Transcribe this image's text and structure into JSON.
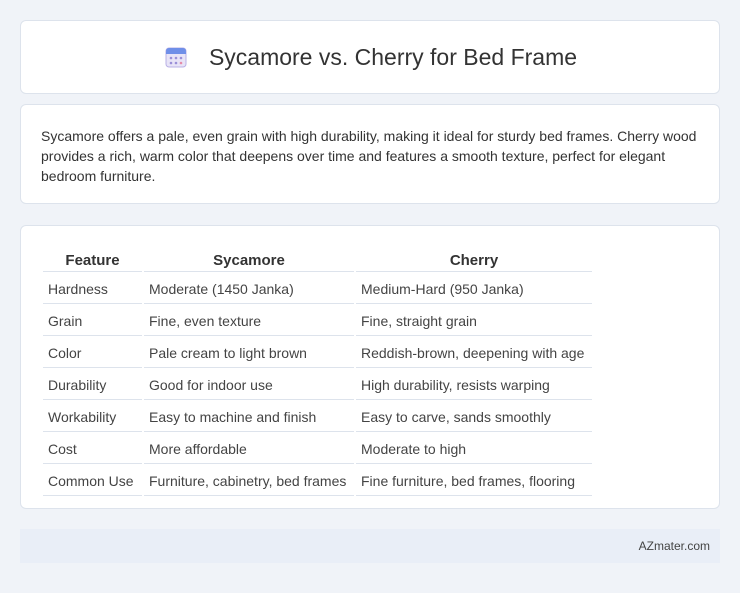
{
  "header": {
    "title": "Sycamore vs. Cherry for Bed Frame",
    "icon": "calendar-icon"
  },
  "summary": {
    "text": "Sycamore offers a pale, even grain with high durability, making it ideal for sturdy bed frames. Cherry wood provides a rich, warm color that deepens over time and features a smooth texture, perfect for elegant bedroom furniture."
  },
  "table": {
    "headers": [
      "Feature",
      "Sycamore",
      "Cherry"
    ],
    "rows": [
      [
        "Hardness",
        "Moderate (1450 Janka)",
        "Medium-Hard (950 Janka)"
      ],
      [
        "Grain",
        "Fine, even texture",
        "Fine, straight grain"
      ],
      [
        "Color",
        "Pale cream to light brown",
        "Reddish-brown, deepening with age"
      ],
      [
        "Durability",
        "Good for indoor use",
        "High durability, resists warping"
      ],
      [
        "Workability",
        "Easy to machine and finish",
        "Easy to carve, sands smoothly"
      ],
      [
        "Cost",
        "More affordable",
        "Moderate to high"
      ],
      [
        "Common Use",
        "Furniture, cabinetry, bed frames",
        "Fine furniture, bed frames, flooring"
      ]
    ]
  },
  "footer": {
    "text": "AZmater.com"
  }
}
